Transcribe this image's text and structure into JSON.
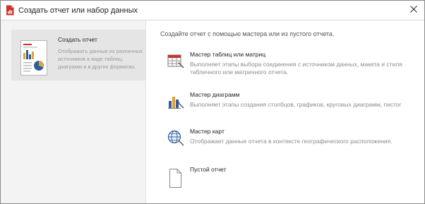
{
  "window": {
    "title": "Создать отчет или набор данных",
    "title_icon": "report-builder-icon",
    "close_icon": "close-icon"
  },
  "sidebar": {
    "items": [
      {
        "title": "Создать отчет",
        "description": [
          "Отображать данные из различных",
          "источников в виде таблиц,",
          "диаграмм и в других форматах."
        ],
        "icon": "report-thumbnail-icon",
        "selected": true
      }
    ]
  },
  "main": {
    "intro": "Создайте отчет с помощью мастера или из пустого отчета.",
    "options": [
      {
        "title": "Мастер таблиц или матриц",
        "description": [
          "Выполняет этапы выбора соединения с источником данных, макета и стиля",
          "табличного или матричного отчета."
        ],
        "icon": "table-wizard-icon"
      },
      {
        "title": "Мастер диаграмм",
        "description": [
          "Выполняет этапы создания столбцов, графиков, круговых диаграмм, пистог"
        ],
        "icon": "chart-wizard-icon"
      },
      {
        "title": "Мастер карт",
        "description": [
          "Отображает данные отчета в контексте географического расположения."
        ],
        "icon": "map-wizard-icon"
      },
      {
        "title": "Пустой отчет",
        "description": [],
        "icon": "blank-report-icon"
      }
    ]
  },
  "colors": {
    "accent_red": "#c8332b",
    "sidebar_bg": "#f3f3f3",
    "selected_bg": "#e5e5e5"
  }
}
